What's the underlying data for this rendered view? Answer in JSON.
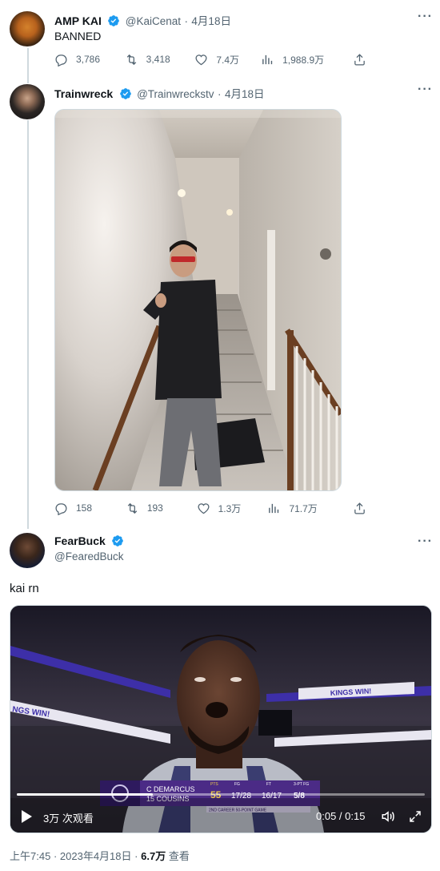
{
  "tweets": [
    {
      "display_name": "AMP KAI",
      "handle": "@KaiCenat",
      "date": "4月18日",
      "text": "BANNED",
      "replies": "3,786",
      "retweets": "3,418",
      "likes": "7.4万",
      "views": "1,988.9万"
    },
    {
      "display_name": "Trainwreck",
      "handle": "@Trainwreckstv",
      "date": "4月18日",
      "replies": "158",
      "retweets": "193",
      "likes": "1.3万",
      "views": "71.7万"
    },
    {
      "display_name": "FearBuck",
      "handle": "@FearedBuck",
      "text": "kai rn",
      "video": {
        "banner_left": "NGS WIN!",
        "banner_right": "KINGS WIN!",
        "ticker_name_1": "C DEMARCUS",
        "ticker_name_2": "15 COUSINS",
        "ticker_pts_label": "PTS",
        "ticker_pts": "55",
        "ticker_fg_label": "FG",
        "ticker_fg": "17/28",
        "ticker_ft_label": "FT",
        "ticker_ft": "16/17",
        "ticker_3p_label": "3-PT FG",
        "ticker_3p": "5/8",
        "ticker_sub": "2ND CAREER 50-POINT GAME",
        "views_label": "3万 次观看",
        "time": "0:05 / 0:15",
        "progress": 0.333
      }
    }
  ],
  "footer": {
    "time": "上午7:45",
    "separator": "·",
    "date": "2023年4月18日",
    "views_count": "6.7万",
    "views_label": "查看"
  },
  "colors": {
    "verified": "#1d9bf0",
    "meta": "#536471",
    "ticker": "#4b2b86"
  },
  "icons": [
    "reply-icon",
    "retweet-icon",
    "like-icon",
    "views-icon",
    "share-icon",
    "more-icon",
    "play-icon",
    "volume-icon",
    "fullscreen-icon"
  ]
}
